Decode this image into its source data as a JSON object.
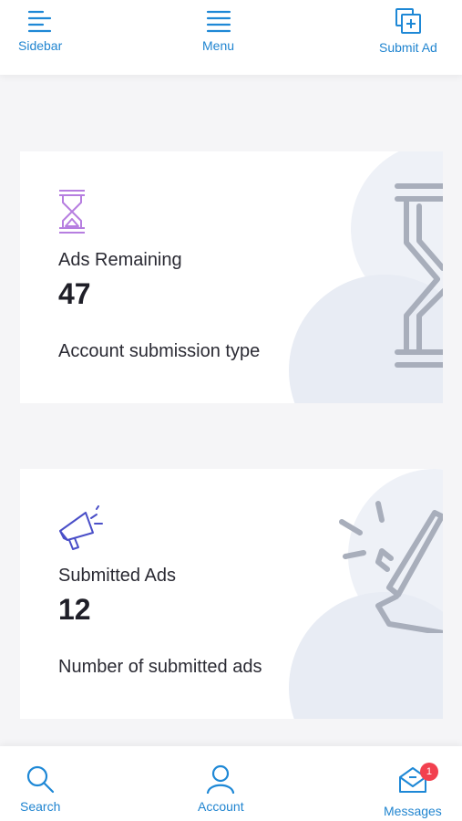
{
  "topbar": {
    "sidebar_label": "Sidebar",
    "menu_label": "Menu",
    "submit_label": "Submit Ad"
  },
  "cards": [
    {
      "title": "Ads Remaining",
      "value": "47",
      "description": "Account submission type",
      "icon": "hourglass-icon"
    },
    {
      "title": "Submitted Ads",
      "value": "12",
      "description": "Number of submitted ads",
      "icon": "megaphone-icon"
    }
  ],
  "bottombar": {
    "search_label": "Search",
    "account_label": "Account",
    "messages_label": "Messages",
    "messages_badge": "1"
  },
  "colors": {
    "accent": "#1e88d6",
    "icon_purple": "#b67ee0",
    "icon_indigo": "#4a4fc8",
    "badge": "#f2404f"
  }
}
